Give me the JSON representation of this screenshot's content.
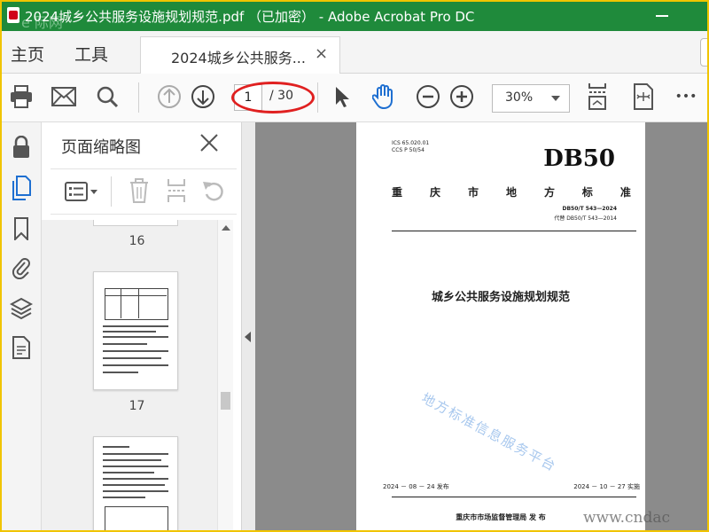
{
  "window": {
    "title": "2024城乡公共服务设施规划规范.pdf （已加密） - Adobe Acrobat Pro DC",
    "watermark_tl": "e 际网"
  },
  "tabs": {
    "home": "主页",
    "tools": "工具",
    "doc_tab": "2024城乡公共服务...",
    "close": "×"
  },
  "toolbar": {
    "current_page": "1",
    "total_pages": "/ 30",
    "zoom": "30%",
    "more": "•••"
  },
  "thumbnails": {
    "title": "页面缩略图",
    "pages": [
      "16",
      "17"
    ]
  },
  "document": {
    "ics": "ICS  65.020.01",
    "ccs": "CCS  P 50/54",
    "code": "DB50",
    "std_name": [
      "重",
      "庆",
      "市",
      "地",
      "方",
      "标",
      "准"
    ],
    "std_no": "DB50/T 543—2024",
    "replaces": "代替 DB50/T 543—2014",
    "title": "城乡公共服务设施规划规范",
    "stamp": "地方标准信息服务平台",
    "issue_date": "2024 － 08 － 24 发布",
    "impl_date": "2024 － 10 － 27 实施",
    "bureau": "重庆市市场监督管理局   发 布"
  },
  "site_watermark": "www.cndac",
  "colors": {
    "titlebar": "#1f8a3b",
    "accent_blue": "#1e6fd1",
    "annotation_red": "#e02020"
  }
}
